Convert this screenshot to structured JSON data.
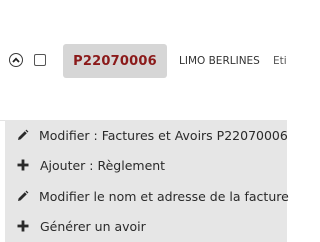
{
  "row": {
    "reference": "P22070006",
    "client": "LIMO BERLINES",
    "extra_text": "Eti",
    "expand_icon": "chevron-up-circle-icon",
    "reference_color": "#8b1a1a"
  },
  "menu": {
    "items": [
      {
        "icon": "pencil-icon",
        "label": "Modifier : Factures et Avoirs P22070006"
      },
      {
        "icon": "plus-icon",
        "label": "Ajouter : Règlement"
      },
      {
        "icon": "pencil-icon",
        "label": "Modifier le nom et adresse de la facture"
      },
      {
        "icon": "plus-icon",
        "label": "Générer un avoir"
      }
    ]
  }
}
